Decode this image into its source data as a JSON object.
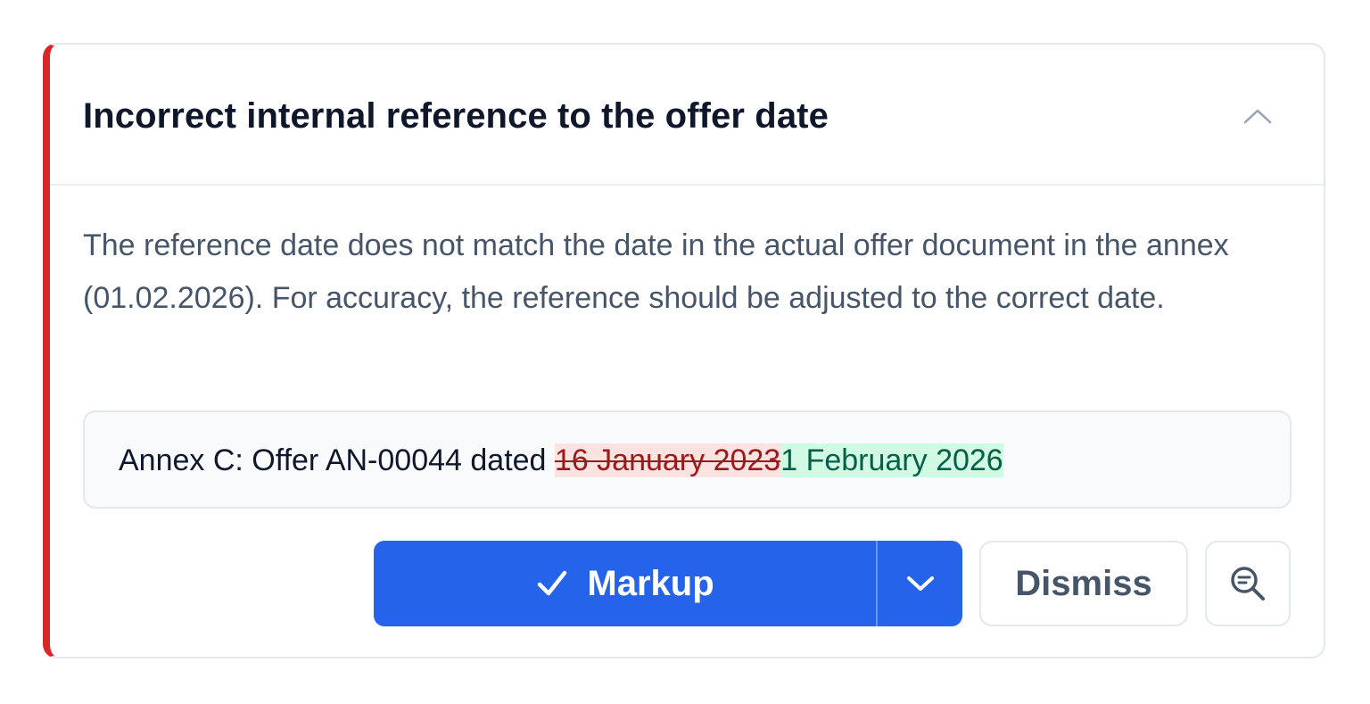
{
  "issue": {
    "title": "Incorrect internal reference to the offer date",
    "description": "The reference date does not match the date in the actual offer document in the annex (01.02.2026). For accuracy, the reference should be adjusted to the correct date.",
    "severity_color": "#dc2626"
  },
  "suggestion": {
    "prefix": "Annex C: Offer AN-00044 dated ",
    "deleted": "16 January 2023",
    "inserted": "1 February 2026"
  },
  "actions": {
    "markup_label": "Markup",
    "dismiss_label": "Dismiss"
  },
  "icons": {
    "collapse": "chevron-up-icon",
    "markup": "check-icon",
    "dropdown": "chevron-down-icon",
    "inspect": "search-text-icon"
  },
  "colors": {
    "accent": "#2563eb",
    "deleted_bg": "#fde2e2",
    "deleted_text": "#991b1b",
    "inserted_bg": "#d1fae5",
    "inserted_text": "#065f46"
  }
}
